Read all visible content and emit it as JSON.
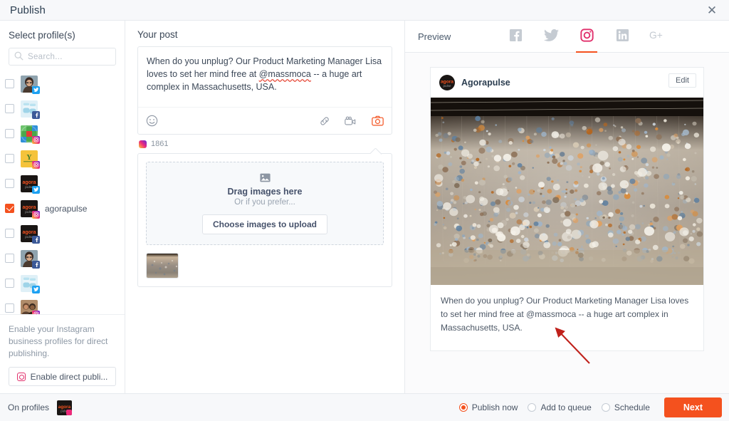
{
  "window": {
    "title": "Publish",
    "close_icon": "close-icon"
  },
  "left_panel": {
    "heading": "Select profile(s)",
    "search": {
      "placeholder": "Search...",
      "value": "",
      "icon": "search-icon"
    },
    "profiles": [
      {
        "name": "",
        "network": "twitter",
        "checked": false,
        "avatar": "woman-glasses"
      },
      {
        "name": "",
        "network": "facebook",
        "checked": false,
        "avatar": "surgeons"
      },
      {
        "name": "",
        "network": "instagram",
        "checked": false,
        "avatar": "colorful-grid"
      },
      {
        "name": "",
        "network": "instagram",
        "checked": false,
        "avatar": "yellow-y"
      },
      {
        "name": "",
        "network": "twitter",
        "checked": false,
        "avatar": "agorapulse-logo"
      },
      {
        "name": "agorapulse",
        "network": "instagram",
        "checked": true,
        "avatar": "agorapulse-logo"
      },
      {
        "name": "",
        "network": "facebook",
        "checked": false,
        "avatar": "agorapulse-logo"
      },
      {
        "name": "",
        "network": "facebook",
        "checked": false,
        "avatar": "woman-glasses"
      },
      {
        "name": "",
        "network": "twitter",
        "checked": false,
        "avatar": "surgeons"
      },
      {
        "name": "",
        "network": "instagram",
        "checked": false,
        "avatar": "two-people"
      }
    ],
    "instagram_note": "Enable your Instagram business profiles for direct publishing.",
    "enable_button": {
      "label": "Enable direct publi...",
      "icon": "instagram-icon"
    }
  },
  "middle_panel": {
    "heading": "Your post",
    "post_text_before": "When do you unplug? Our Product Marketing Manager Lisa loves to set her mind free at ",
    "post_mention": "@massmoca",
    "post_text_after": " -- a huge art complex in Massachusetts, USA.",
    "toolbar": {
      "emoji_icon": "smiley-icon",
      "link_icon": "link-icon",
      "video_icon": "video-camera-icon",
      "image_icon": "camera-icon"
    },
    "character_count": "1861",
    "dropzone": {
      "icon": "image-placeholder-icon",
      "title": "Drag images here",
      "subtitle": "Or if you prefer...",
      "button": "Choose images to upload"
    },
    "attached_thumbnails": 1
  },
  "right_panel": {
    "label": "Preview",
    "networks": [
      {
        "name": "facebook",
        "icon": "facebook-icon",
        "active": false
      },
      {
        "name": "twitter",
        "icon": "twitter-icon",
        "active": false
      },
      {
        "name": "instagram",
        "icon": "instagram-icon",
        "active": true
      },
      {
        "name": "linkedin",
        "icon": "linkedin-icon",
        "active": false
      },
      {
        "name": "googleplus",
        "icon": "google-plus-icon",
        "active": false
      }
    ],
    "card": {
      "account_name": "Agorapulse",
      "edit_label": "Edit",
      "caption": "When do you unplug? Our Product Marketing Manager Lisa loves to set her mind free at @massmoca -- a huge art complex in Massachusetts, USA.",
      "image_alt": "art-installation-hanging-objects"
    },
    "annotation": {
      "type": "red-arrow",
      "points_to": "@massmoca",
      "color": "#c0211b"
    }
  },
  "footer": {
    "on_profiles_label": "On profiles",
    "selected_avatar": "agorapulse-logo",
    "options": [
      {
        "label": "Publish now",
        "selected": true
      },
      {
        "label": "Add to queue",
        "selected": false
      },
      {
        "label": "Schedule",
        "selected": false
      }
    ],
    "next_button": "Next"
  },
  "colors": {
    "accent": "#f4511e",
    "instagram": "#e1306c",
    "twitter": "#1da1f2",
    "facebook": "#3b5998",
    "annotation": "#c0211b"
  }
}
